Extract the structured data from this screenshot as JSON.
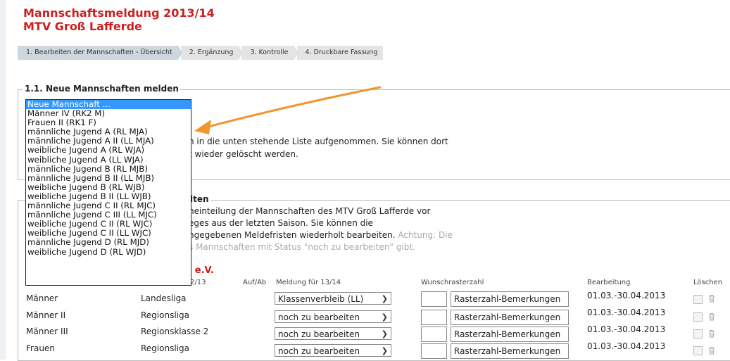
{
  "header": {
    "title_line1": "Mannschaftsmeldung 2013/14",
    "title_line2": "MTV Groß Lafferde"
  },
  "steps": [
    {
      "label": "1.  Bearbeiten der Mannschaften - Übersicht"
    },
    {
      "label": "2.  Ergänzung"
    },
    {
      "label": "3.  Kontrolle"
    },
    {
      "label": "4.  Druckbare Fassung"
    }
  ],
  "section1": {
    "legend": "1.1. Neue Mannschaften melden",
    "text_line1": "n in die unten stehende Liste aufgenommen. Sie können dort",
    "text_line2": "t wieder gelöscht werden."
  },
  "dropdown": {
    "options": [
      "Neue Mannschaft ...",
      "Männer IV (RK2 M)",
      "Frauen II (RK1 F)",
      "männliche Jugend A (RL MJA)",
      "männliche Jugend A II (LL MJA)",
      "weibliche Jugend A (RL WJA)",
      "weibliche Jugend A (LL WJA)",
      "männliche Jugend B (RL MJB)",
      "männliche Jugend B II (LL MJB)",
      "weibliche Jugend B (RL WJB)",
      "weibliche Jugend B II (LL WJB)",
      "männliche Jugend C II (RL MJC)",
      "männliche Jugend C III (LL MJC)",
      "weibliche Jugend C II (RL WJC)",
      "weibliche Jugend C II (LL WJC)",
      "männliche Jugend D (RL MJD)",
      "weibliche Jugend D (RL WJD)"
    ],
    "selected_index": 0
  },
  "section2": {
    "legend_tail": "lten",
    "line1": "neinteilung der Mannschaften des MTV Groß Lafferde vor",
    "line2": "eges aus der letzten Saison. Sie können die",
    "line3_main": "ngegebenen Meldefristen wiederholt bearbeiten.",
    "line3_grey": "Achtung: Die",
    "line4_grey": "s Mannschaften mit Status \"noch zu bearbeiten\" gibt.",
    "club_tail": "n e.V."
  },
  "table": {
    "headers": {
      "season": "2/13",
      "aufab": "Auf/Ab",
      "meldung": "Meldung für 13/14",
      "wunsch": "Wunschrasterzahl",
      "bearbeitung": "Bearbeitung",
      "loeschen": "Löschen"
    },
    "rows": [
      {
        "team": "Männer",
        "league": "Landesliga",
        "meldung": "Klassenverbleib (LL)",
        "note": "Rasterzahl-Bemerkungen",
        "period": "01.03.-30.04.2013"
      },
      {
        "team": "Männer II",
        "league": "Regionsliga",
        "meldung": "noch zu bearbeiten",
        "note": "Rasterzahl-Bemerkungen",
        "period": "01.03.-30.04.2013"
      },
      {
        "team": "Männer III",
        "league": "Regionsklasse 2",
        "meldung": "noch zu bearbeiten",
        "note": "Rasterzahl-Bemerkungen",
        "period": "01.03.-30.04.2013"
      },
      {
        "team": "Frauen",
        "league": "Regionsliga",
        "meldung": "noch zu bearbeiten",
        "note": "Rasterzahl-Bemerkungen",
        "period": "01.03.-30.04.2013"
      }
    ]
  },
  "colors": {
    "title": "#cc1f1f",
    "selection": "#3399ff",
    "arrow": "#f0962d"
  }
}
